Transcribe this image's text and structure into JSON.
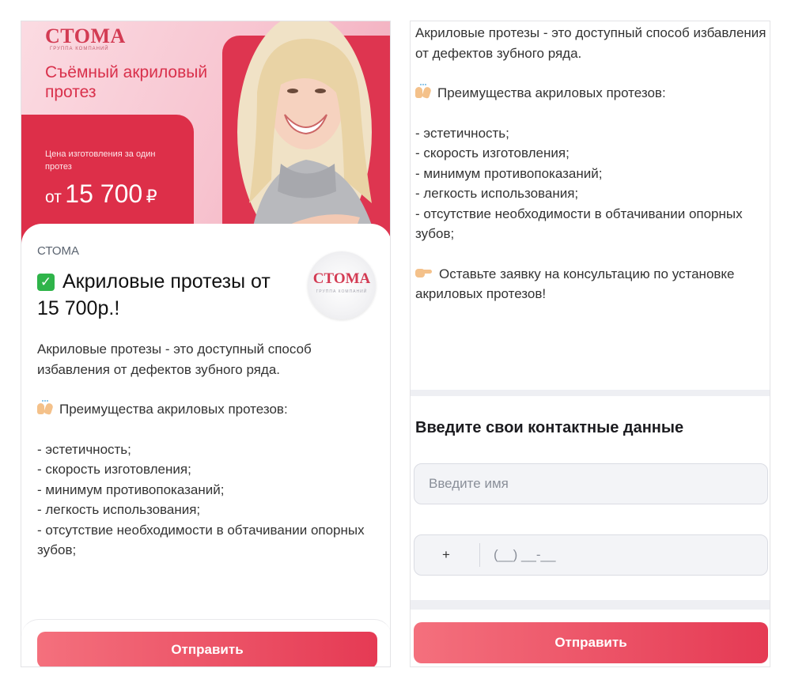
{
  "left": {
    "banner": {
      "logo": "СТОМА",
      "logo_sub": "ГРУППА КОМПАНИЙ",
      "title": "Съёмный акриловый протез",
      "price_label": "Цена изготовления за один протез",
      "price_prefix": "от",
      "price_value": "15 700",
      "currency": "₽"
    },
    "company": "СТОМА",
    "title": "Акриловые протезы от 15 700р.!",
    "avatar_logo": "СТОМА",
    "avatar_sub": "ГРУППА КОМПАНИЙ",
    "description": {
      "intro": "Акриловые протезы - это доступный способ избавления от дефектов зубного ряда.",
      "benefits_heading": "Преимущества акриловых протезов:",
      "benefits": [
        "- эстетичность;",
        "- скорость изготовления;",
        "- минимум противопоказаний;",
        "- легкость использования;",
        "- отсутствие необходимости в обтачивании опорных зубов;"
      ]
    },
    "submit_label": "Отправить"
  },
  "right": {
    "description": {
      "intro": "Акриловые протезы - это доступный способ избавления от дефектов зубного ряда.",
      "benefits_heading": "Преимущества акриловых протезов:",
      "benefits": [
        "- эстетичность;",
        "- скорость изготовления;",
        "- минимум противопоказаний;",
        "- легкость использования;",
        "- отсутствие необходимости в обтачивании опорных зубов;"
      ],
      "cta": "Оставьте заявку на консультацию по установке акриловых протезов!"
    },
    "form": {
      "title": "Введите свои контактные данные",
      "name_placeholder": "Введите имя",
      "phone_prefix": "+",
      "phone_mask": "(__) __-__"
    },
    "submit_label": "Отправить"
  },
  "colors": {
    "brand_red": "#dd2f49",
    "button_gradient_start": "#f4707d",
    "button_gradient_end": "#e53a54",
    "check_green": "#2fb44a"
  },
  "icons": [
    "check-icon",
    "raising-hands-emoji",
    "pointing-right-emoji"
  ]
}
